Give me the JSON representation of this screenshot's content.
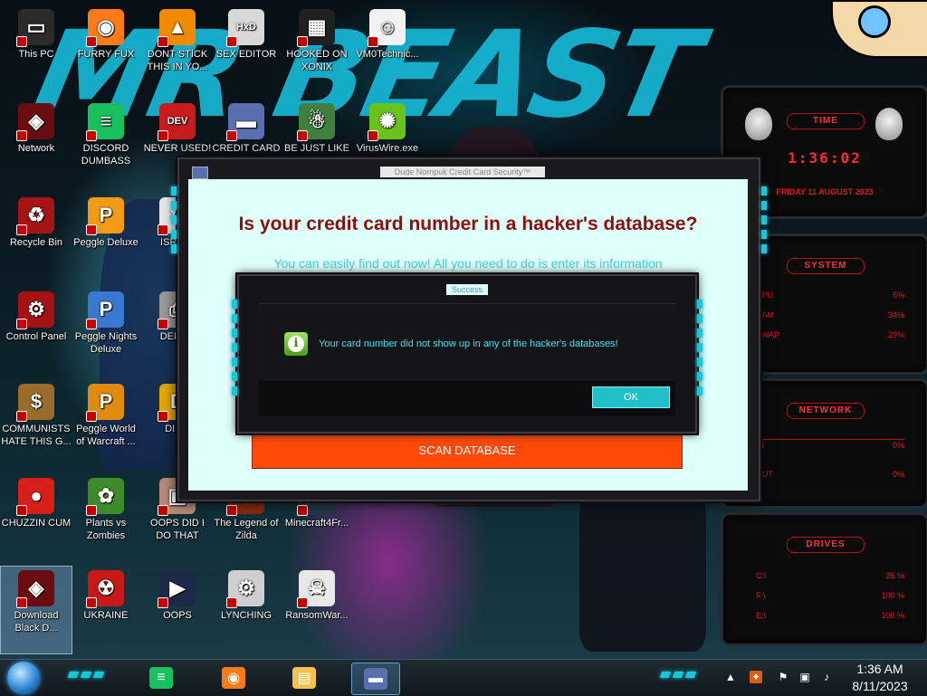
{
  "wallpaper": {
    "text": "MR BEAST"
  },
  "desktop_icons": [
    {
      "label": "This PC",
      "icon": "computer-icon",
      "color": "#2b2b2b"
    },
    {
      "label": "FURRY FUX",
      "icon": "firefox-icon",
      "color": "#ff7a18"
    },
    {
      "label": "DONT STICK THIS IN YO...",
      "icon": "vlc-cone-icon",
      "color": "#f08a00"
    },
    {
      "label": "SEX EDITOR",
      "icon": "hxd-editor-icon",
      "color": "#d8d8d8"
    },
    {
      "label": "HOOKED ON XONIX",
      "icon": "xonix-game-icon",
      "color": "#202020"
    },
    {
      "label": "VM0Technic...",
      "icon": "doctor-icon",
      "color": "#f2f2f2"
    },
    {
      "label": "Network",
      "icon": "alienware-network-icon",
      "color": "#6a0d10"
    },
    {
      "label": "DISCORD DUMBASS",
      "icon": "chat-bubble-icon",
      "color": "#18c060"
    },
    {
      "label": "NEVER USED!",
      "icon": "devcpp-icon",
      "color": "#c81b1b"
    },
    {
      "label": "CREDIT CARD",
      "icon": "credit-card-icon",
      "color": "#5a6fb0"
    },
    {
      "label": "BE JUST LIKE",
      "icon": "santa-icon",
      "color": "#3f7f3f"
    },
    {
      "label": "VirusWire.exe",
      "icon": "lime-icon",
      "color": "#68c21a"
    },
    {
      "label": "Recycle Bin",
      "icon": "recycle-bin-icon",
      "color": "#a61515"
    },
    {
      "label": "Peggle Deluxe",
      "icon": "peggle-icon",
      "color": "#f39a16"
    },
    {
      "label": "ISRAI...",
      "icon": "israel-icon",
      "color": "#e7e7e7"
    },
    {
      "label": "Control Panel",
      "icon": "control-panel-icon",
      "color": "#a31313"
    },
    {
      "label": "Peggle Nights Deluxe",
      "icon": "peggle-nights-icon",
      "color": "#3a78d0"
    },
    {
      "label": "DEEZ...",
      "icon": "printer-icon",
      "color": "#9a9a9a"
    },
    {
      "label": "COMMUNISTS HATE THIS G...",
      "icon": "money-bag-icon",
      "color": "#9b6b2c"
    },
    {
      "label": "Peggle World of Warcraft ...",
      "icon": "peggle-wow-icon",
      "color": "#e08a10"
    },
    {
      "label": "DIE...",
      "icon": "d-letter-icon",
      "color": "#e0a800"
    },
    {
      "label": "CHUZZIN CUM",
      "icon": "chuzzle-icon",
      "color": "#d8201a"
    },
    {
      "label": "Plants vs Zombies",
      "icon": "pvz-icon",
      "color": "#3d8a2a"
    },
    {
      "label": "OOPS DID I DO THAT",
      "icon": "photo-icon",
      "color": "#b58a78"
    },
    {
      "label": "The Legend of Zilda",
      "icon": "zelda-icon",
      "color": "#8a2a10"
    },
    {
      "label": "Minecraft4Fr...",
      "icon": "blank-icon",
      "color": "#223a44"
    },
    {
      "label": "Download Black D...",
      "icon": "alienware-download-icon",
      "color": "#6a0d10"
    },
    {
      "label": "UKRAINE",
      "icon": "radiation-icon",
      "color": "#c81818"
    },
    {
      "label": "OOPS",
      "icon": "media-player-icon",
      "color": "#1c2a48"
    },
    {
      "label": "LYNCHING",
      "icon": "gear-network-icon",
      "color": "#cfcfcf"
    },
    {
      "label": "RansomWar...",
      "icon": "skull-icon",
      "color": "#e8e8e8"
    }
  ],
  "widgets": {
    "time": {
      "title": "TIME",
      "clock": "1:36:02",
      "date": "FRIDAY 11 AUGUST 2023"
    },
    "system": {
      "title": "SYSTEM",
      "rows": [
        {
          "label": "CPU",
          "value": "6%"
        },
        {
          "label": "RAM",
          "value": "34%"
        },
        {
          "label": "SWAP",
          "value": "29%"
        }
      ]
    },
    "network": {
      "title": "NETWORK",
      "rows": [
        {
          "label": "IN",
          "value": "0%"
        },
        {
          "label": "OUT",
          "value": "0%"
        }
      ]
    },
    "drives": {
      "title": "DRIVES",
      "rows": [
        {
          "label": "C:\\",
          "value": "26 %"
        },
        {
          "label": "F:\\",
          "value": "100 %"
        },
        {
          "label": "E:\\",
          "value": "100 %"
        }
      ]
    }
  },
  "main_window": {
    "title": "Dude Nornpuk Credit Card Security™",
    "headline": "Is your credit card number in a hacker's database?",
    "subline": "You can easily find out now! All you need to do is enter its information",
    "scan_button": "SCAN DATABASE"
  },
  "dialog": {
    "title": "Success",
    "message": "Your card number did not show up in any of the hacker's databases!",
    "ok_button": "OK"
  },
  "taskbar": {
    "pinned": [
      {
        "name": "taskbar-chat-app",
        "icon": "chat-bubble-icon",
        "color": "#18c060"
      },
      {
        "name": "taskbar-firefox",
        "icon": "firefox-icon",
        "color": "#ff7a18"
      },
      {
        "name": "taskbar-file-explorer",
        "icon": "folder-icon",
        "color": "#f2c14e"
      },
      {
        "name": "taskbar-credit-card-app",
        "icon": "credit-card-icon",
        "color": "#5a6fb0"
      }
    ],
    "time": "1:36 AM",
    "date": "8/11/2023"
  }
}
